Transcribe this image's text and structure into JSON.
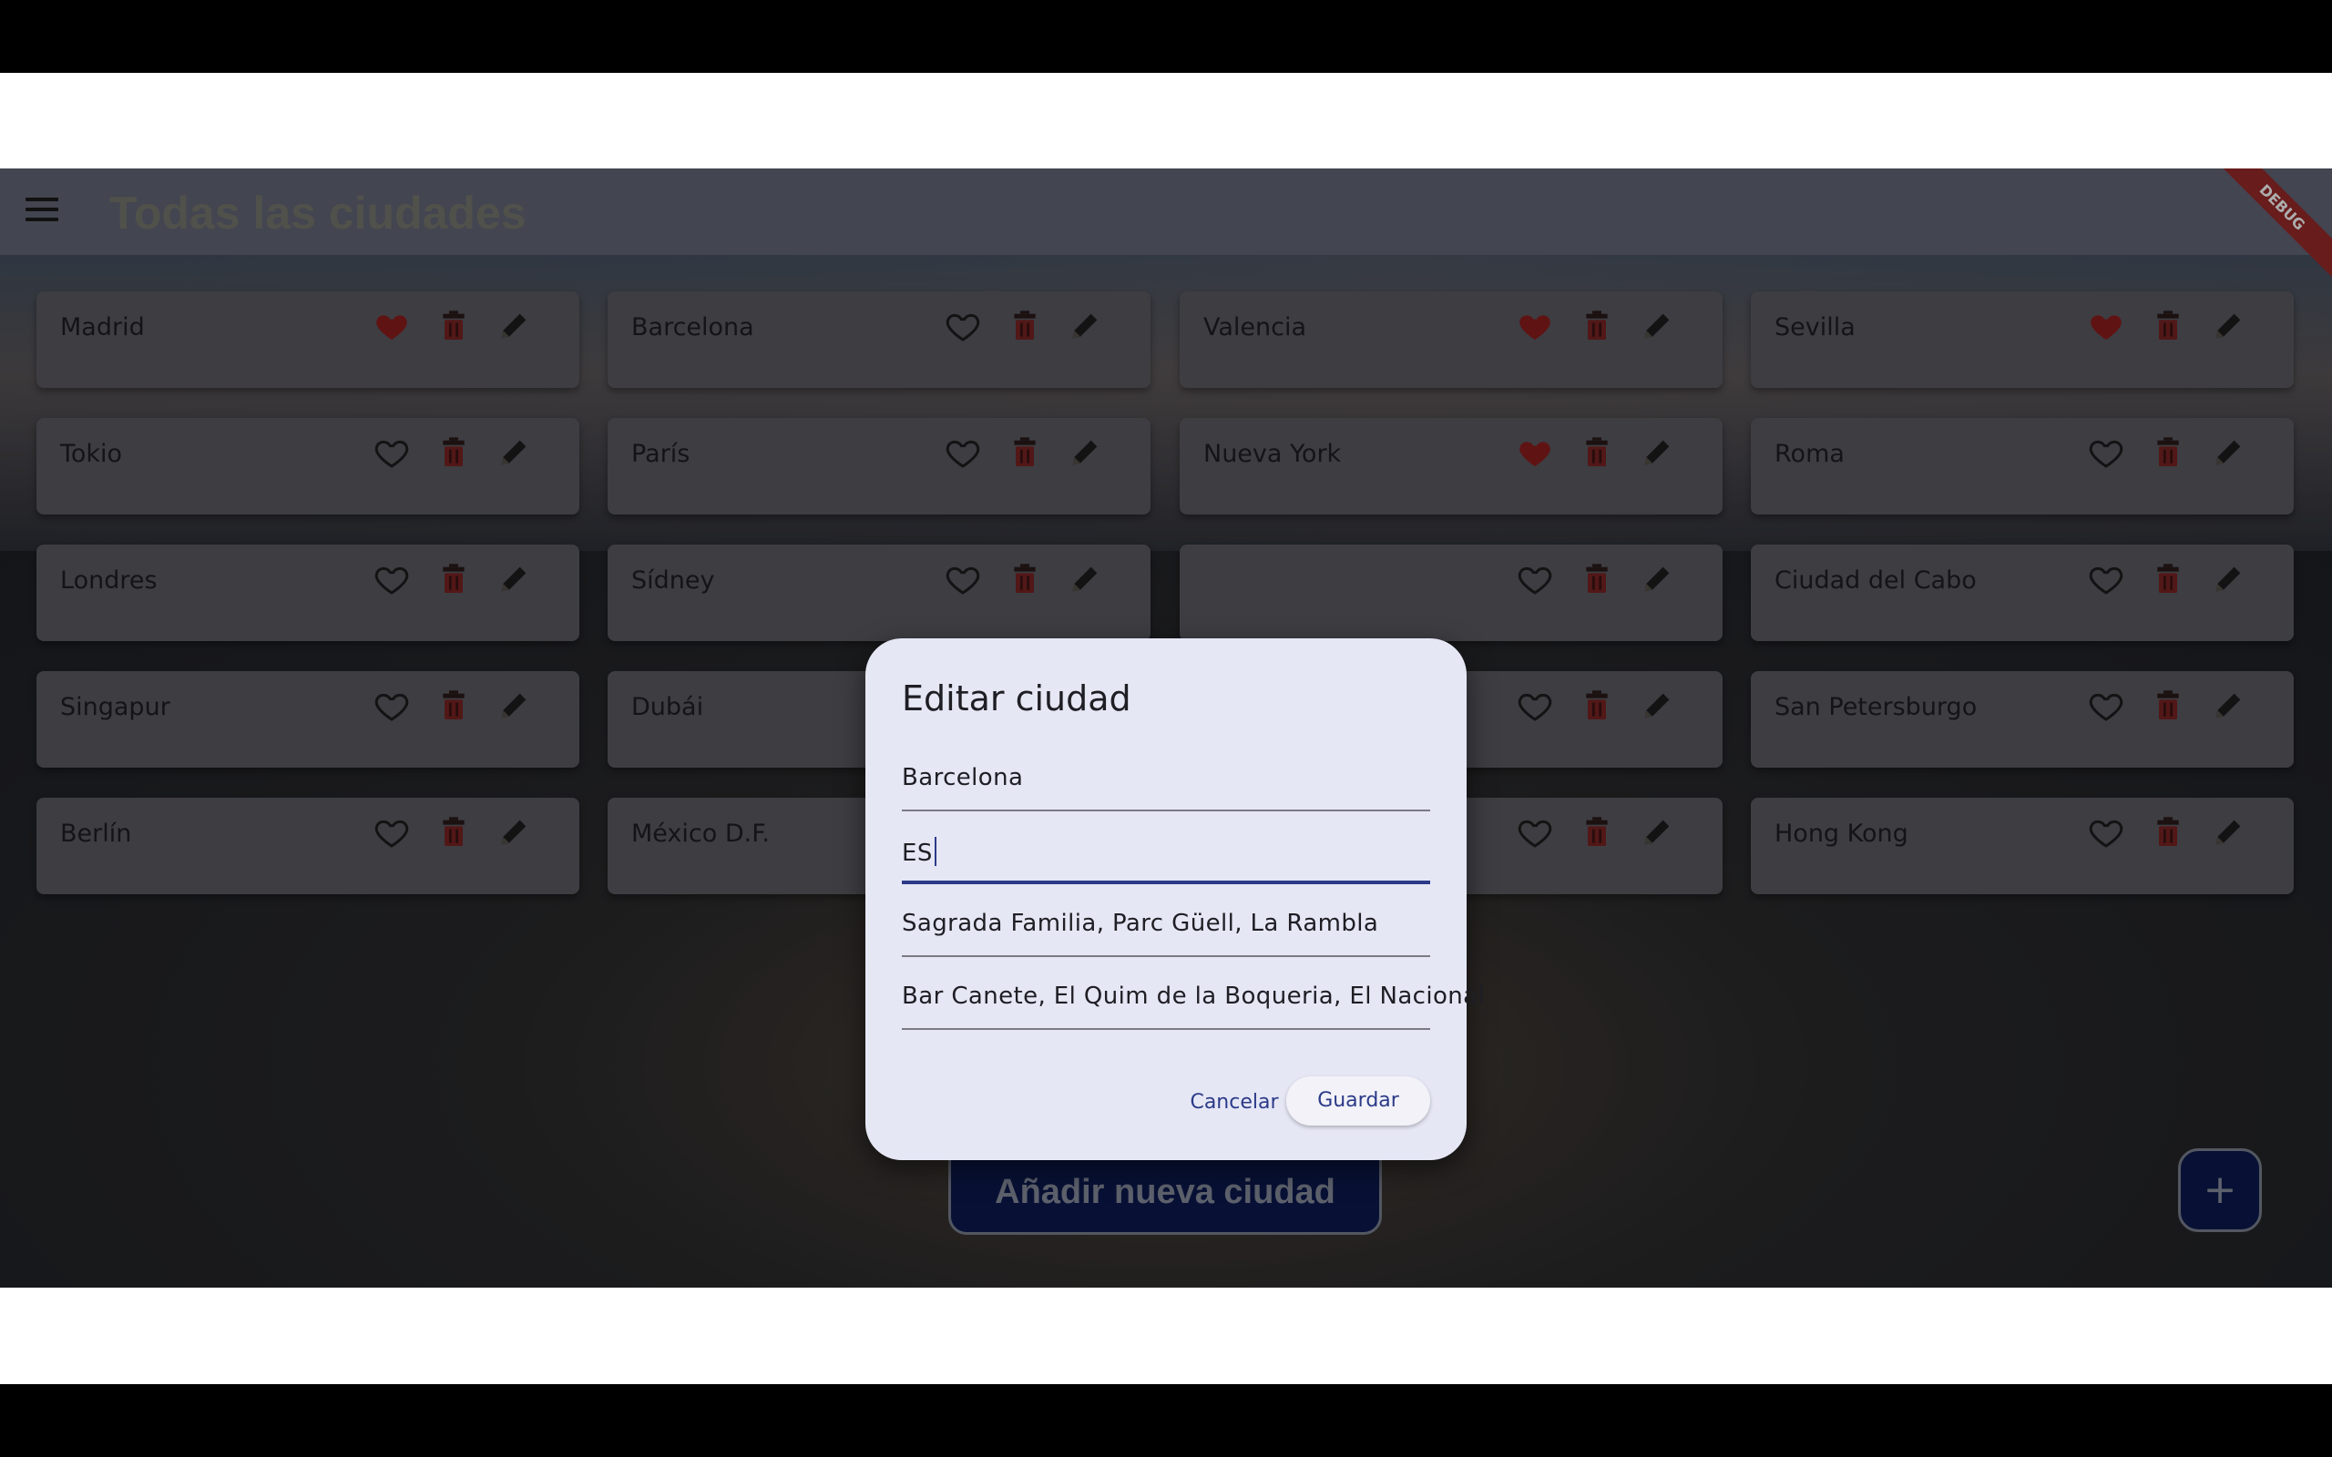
{
  "appbar": {
    "title": "Todas las ciudades",
    "debug_banner": "DEBUG"
  },
  "cities": [
    {
      "name": "Madrid",
      "favorite": true
    },
    {
      "name": "Barcelona",
      "favorite": false
    },
    {
      "name": "Valencia",
      "favorite": true
    },
    {
      "name": "Sevilla",
      "favorite": true
    },
    {
      "name": "Tokio",
      "favorite": false
    },
    {
      "name": "París",
      "favorite": false
    },
    {
      "name": "Nueva York",
      "favorite": true
    },
    {
      "name": "Roma",
      "favorite": false
    },
    {
      "name": "Londres",
      "favorite": false
    },
    {
      "name": "Sídney",
      "favorite": false
    },
    {
      "name": "",
      "favorite": false
    },
    {
      "name": "Ciudad del Cabo",
      "favorite": false
    },
    {
      "name": "Singapur",
      "favorite": false
    },
    {
      "name": "Dubái",
      "favorite": false
    },
    {
      "name": "",
      "favorite": false
    },
    {
      "name": "San Petersburgo",
      "favorite": false
    },
    {
      "name": "Berlín",
      "favorite": false
    },
    {
      "name": "México D.F.",
      "favorite": false
    },
    {
      "name": "",
      "favorite": false
    },
    {
      "name": "Hong Kong",
      "favorite": false
    }
  ],
  "icons": {
    "favorite": "heart-icon",
    "delete": "trash-icon",
    "edit": "pencil-icon",
    "menu": "menu-icon",
    "add": "plus-icon"
  },
  "colors": {
    "heart_filled": "#8e1d1d",
    "trash": "#7a2222",
    "pencil": "#1c1c1c",
    "primary": "#2b3a88",
    "button_dark": "#0c1a4e"
  },
  "add_button_label": "Añadir nueva ciudad",
  "fab_label": "+",
  "dialog": {
    "title": "Editar ciudad",
    "fields": [
      {
        "value": "Barcelona"
      },
      {
        "value": "ES"
      },
      {
        "value": "Sagrada Familia, Parc Güell, La Rambla"
      },
      {
        "value": "Bar Canete, El Quim de la Boqueria, El Nacional"
      }
    ],
    "cancel_label": "Cancelar",
    "save_label": "Guardar"
  }
}
